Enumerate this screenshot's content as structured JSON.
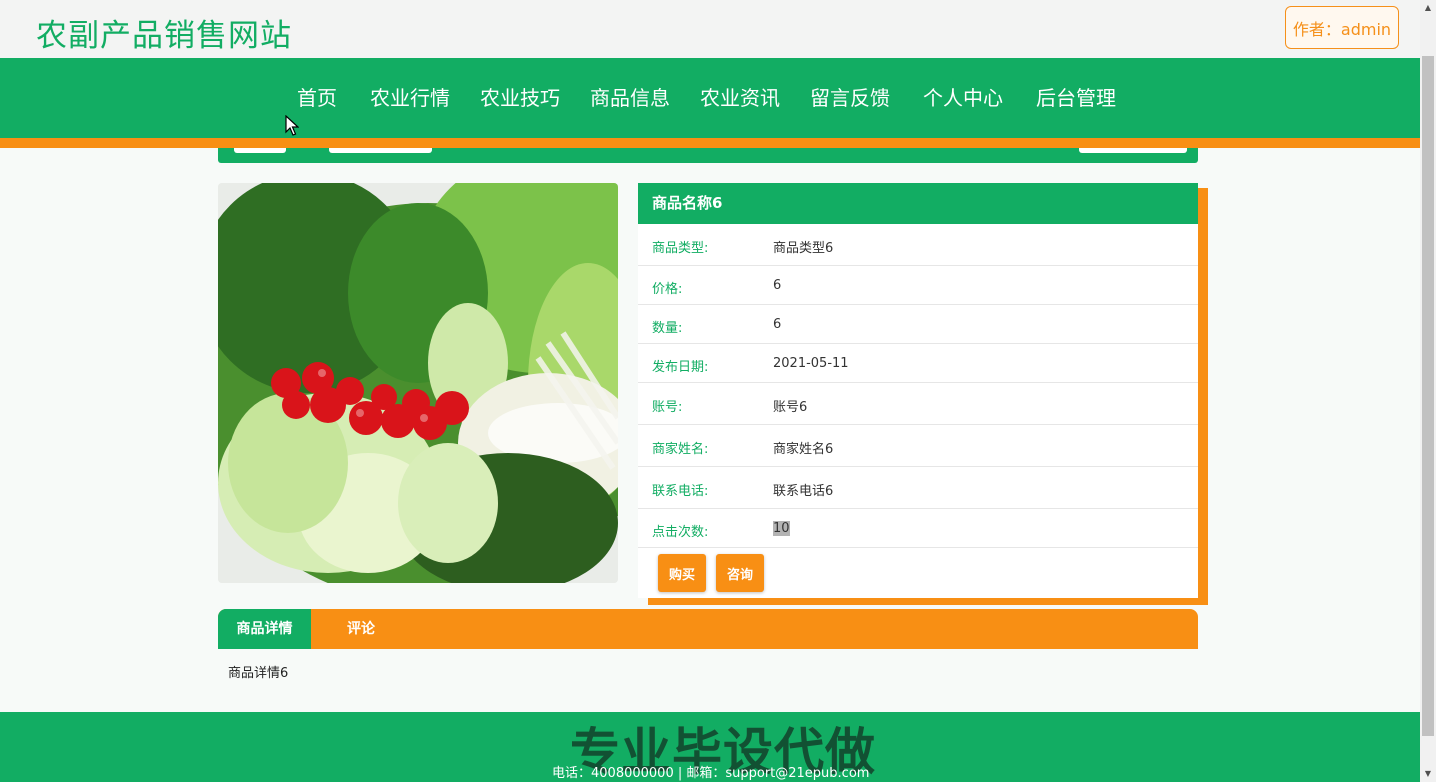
{
  "header": {
    "site_title": "农副产品销售网站",
    "author_label": "作者：admin"
  },
  "nav": {
    "items": [
      "首页",
      "农业行情",
      "农业技巧",
      "商品信息",
      "农业资讯",
      "留言反馈",
      "个人中心",
      "后台管理"
    ]
  },
  "product": {
    "image_alt": "vegetables",
    "name": "商品名称6",
    "fields": [
      {
        "label": "商品类型:",
        "value": "商品类型6"
      },
      {
        "label": "价格:",
        "value": "6"
      },
      {
        "label": "数量:",
        "value": "6"
      },
      {
        "label": "发布日期:",
        "value": "2021-05-11"
      },
      {
        "label": "账号:",
        "value": "账号6"
      },
      {
        "label": "商家姓名:",
        "value": "商家姓名6"
      },
      {
        "label": "联系电话:",
        "value": "联系电话6"
      },
      {
        "label": "点击次数:",
        "value": "10"
      }
    ],
    "buy_label": "购买",
    "consult_label": "咨询"
  },
  "tabs": {
    "items": [
      "商品详情",
      "评论"
    ],
    "active": "商品详情",
    "content": "商品详情6"
  },
  "footer": {
    "watermark": "专业毕设代做",
    "contact": "电话：4008000000 | 邮箱：support@21epub.com"
  },
  "colors": {
    "primary_green": "#12ad63",
    "accent_orange": "#f88f14"
  }
}
